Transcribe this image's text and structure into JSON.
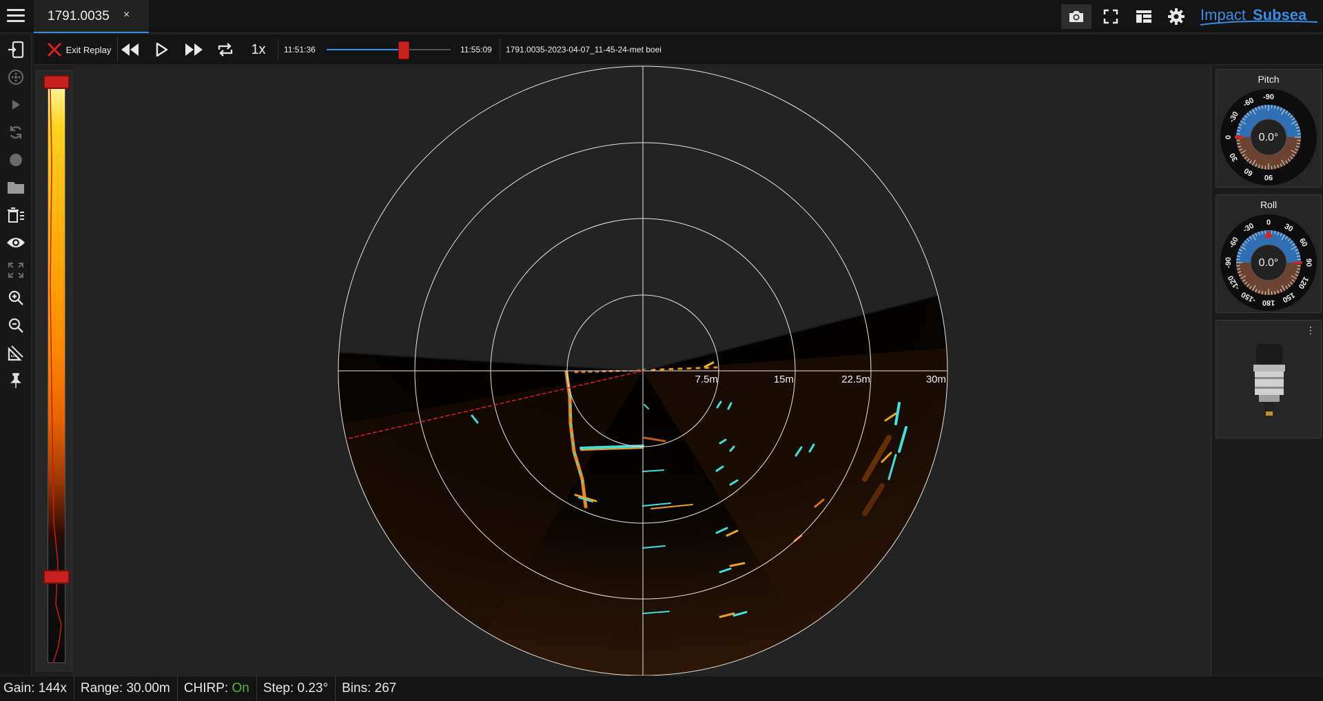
{
  "tab": {
    "label": "1791.0035",
    "close": "×"
  },
  "replay": {
    "exit_label": "Exit Replay",
    "speed": "1x",
    "time_start": "11:51:36",
    "time_end": "11:55:09",
    "position_fraction": 0.62,
    "file_name": "1791.0035-2023-04-07_11-45-24-met boei"
  },
  "brand": {
    "logo_text_a": "Impact",
    "logo_text_b": "Subsea"
  },
  "sonar": {
    "range_labels": [
      "7.5m",
      "15m",
      "22.5m",
      "30m"
    ],
    "bearing_line_color": "#e0201c"
  },
  "colorbar": {
    "upper_level": 0.0,
    "lower_level": 0.85
  },
  "pitch": {
    "title": "Pitch",
    "value": "0.0°",
    "ticks": [
      "-90",
      "-60",
      "-30",
      "0",
      "30",
      "60",
      "90"
    ]
  },
  "roll": {
    "title": "Roll",
    "value": "0.0°",
    "ticks": [
      "0",
      "30",
      "60",
      "90",
      "120",
      "150",
      "180",
      "-150",
      "-120",
      "-90",
      "-60",
      "-30"
    ]
  },
  "sensor": {
    "menu": "⋮"
  },
  "status": {
    "gain": "Gain: 144x",
    "range": "Range: 30.00m",
    "chirp_label": "CHIRP: ",
    "chirp_value": "On",
    "step": "Step: 0.23°",
    "bins": "Bins: 267"
  },
  "colors": {
    "accent": "#3a8ee6",
    "thumb": "#c8211e",
    "chirp_on": "#5fb33b",
    "pitch_sky": "#2f6fb3",
    "pitch_ground": "#6b4330"
  }
}
